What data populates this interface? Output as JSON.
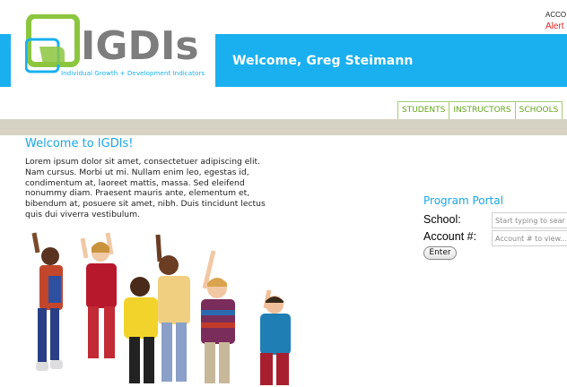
{
  "header": {
    "logo_text": "IGDIs",
    "logo_tagline": "Individual Growth + Development Indicators",
    "account_label": "ACCO",
    "alert_label": "Alert",
    "welcome_text": "Welcome, Greg Steimann"
  },
  "nav": {
    "items": [
      {
        "label": "STUDENTS"
      },
      {
        "label": "INSTRUCTORS"
      },
      {
        "label": "SCHOOLS"
      }
    ]
  },
  "main": {
    "heading": "Welcome to IGDIs!",
    "body": "Lorem ipsum dolor sit amet, consectetuer adipiscing elit. Nam cursus. Morbi ut mi. Nullam enim leo, egestas id, condimentum at, laoreet mattis, massa. Sed eleifend nonummy diam. Praesent mauris ante, elementum et, bibendum at, posuere sit amet, nibh. Duis tincidunt lectus quis dui viverra vestibulum."
  },
  "portal": {
    "title": "Program Portal",
    "school_label": "School:",
    "school_placeholder": "Start typing to sear",
    "account_label": "Account #:",
    "account_placeholder": "Account # to view...",
    "enter_label": "Enter"
  },
  "colors": {
    "brand_blue": "#1ab0ef",
    "brand_green": "#8cc63f",
    "alert_red": "#e0201f",
    "grey_bar": "#d7d3c4"
  }
}
